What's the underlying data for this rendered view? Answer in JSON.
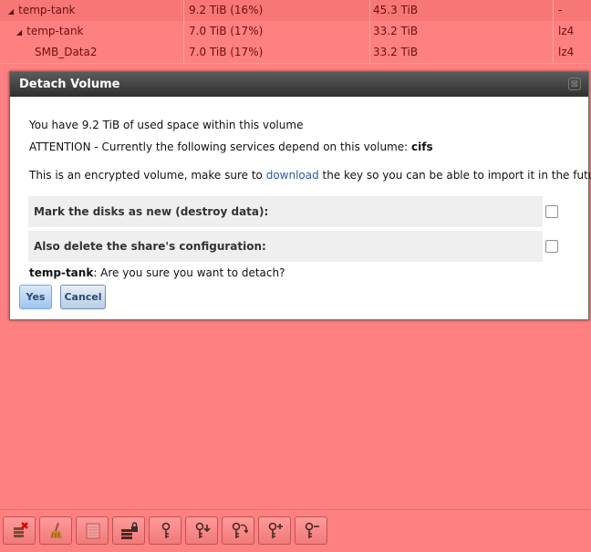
{
  "volume_tree": {
    "rows": [
      {
        "name": "temp-tank",
        "used": "9.2 TiB (16%)",
        "available": "45.3 TiB",
        "compression": "-",
        "expander": "◢"
      },
      {
        "name": "temp-tank",
        "used": "7.0 TiB (17%)",
        "available": "33.2 TiB",
        "compression": "lz4",
        "expander": "◢"
      },
      {
        "name": "SMB_Data2",
        "used": "7.0 TiB (17%)",
        "available": "33.2 TiB",
        "compression": "lz4",
        "expander": ""
      }
    ]
  },
  "dialog": {
    "title": "Detach Volume",
    "close_symbol": "⊠",
    "used_space_text": "You have 9.2 TiB of used space within this volume",
    "attention_prefix": "ATTENTION - Currently the following services depend on this volume: ",
    "attention_service": "cifs",
    "encrypted_prefix": "This is an encrypted volume, make sure to ",
    "encrypted_link": "download",
    "encrypted_suffix": " the key so you can be able to import it in the future",
    "option_mark_disks": "Mark the disks as new (destroy data):",
    "option_delete_share": "Also delete the share's configuration:",
    "option_mark_disks_checked": false,
    "option_delete_share_checked": false,
    "confirm_volume": "temp-tank",
    "confirm_question": ": Are you sure you want to detach?",
    "yes_label": "Yes",
    "cancel_label": "Cancel"
  },
  "toolbar": {
    "buttons": [
      {
        "icon": "detach-volume-icon"
      },
      {
        "icon": "scrub-volume-icon"
      },
      {
        "icon": "volume-status-icon"
      },
      {
        "icon": "lock-volume-icon"
      },
      {
        "icon": "create-passphrase-icon"
      },
      {
        "icon": "download-key-icon"
      },
      {
        "icon": "rekey-icon"
      },
      {
        "icon": "add-recovery-key-icon"
      },
      {
        "icon": "remove-recovery-key-icon"
      }
    ]
  },
  "colors": {
    "background": "#ff8080",
    "dialog_title_bar": "#3a3a3a",
    "link": "#2a5aa6"
  }
}
